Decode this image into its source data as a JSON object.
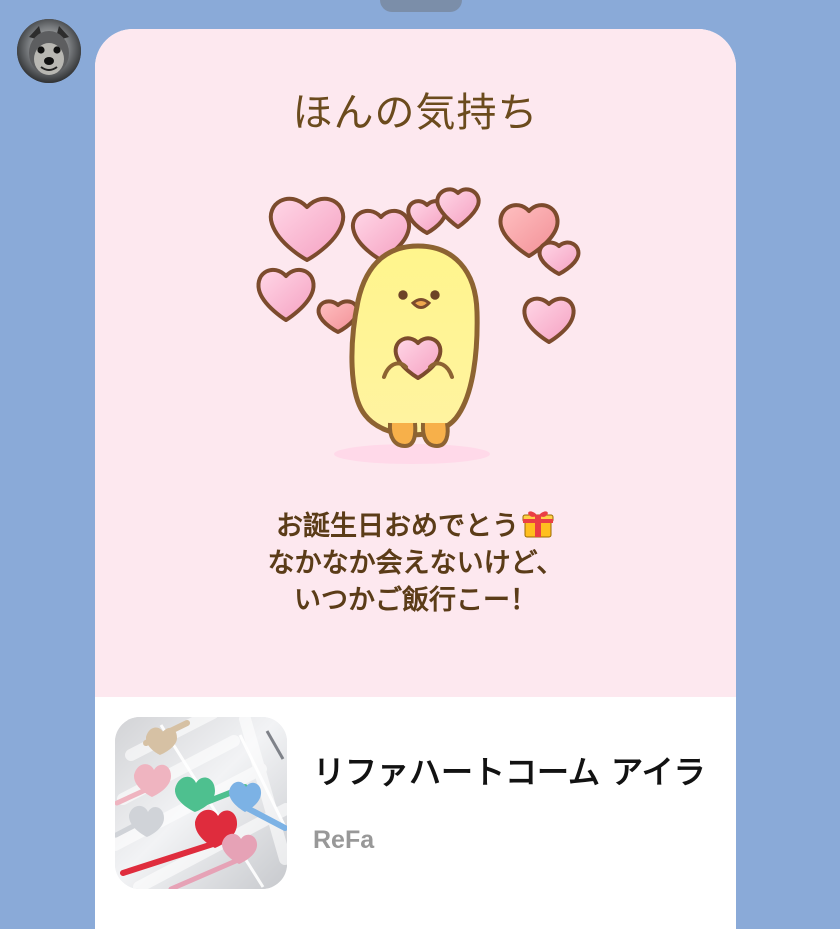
{
  "chat": {
    "background_color": "#8aaad8",
    "message": {
      "card_title": "ほんの気持ち",
      "lines": [
        "お誕生日おめでとう",
        "なかなか会えないけど、",
        "いつかご飯行こー！"
      ],
      "gift_icon": "gift-icon",
      "card_background": "#fde8ef"
    },
    "product": {
      "name": "リファハートコーム アイラ",
      "brand": "ReFa"
    }
  }
}
